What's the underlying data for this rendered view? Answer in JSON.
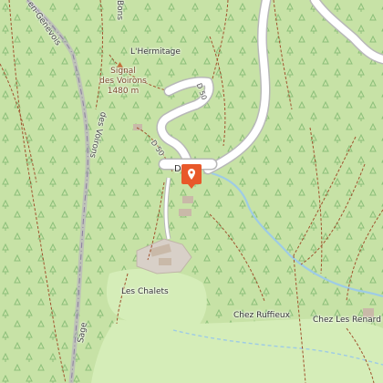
{
  "map": {
    "place_labels": {
      "hermitage": "L'Hermitage",
      "les_chalets": "Les Chalets",
      "chez_ruffieux": "Chez Ruffieux",
      "chez_les_renard": "Chez Les Renard",
      "d_label": "D"
    },
    "peak": {
      "name": "Signal",
      "name2": "des Voirons",
      "elevation": "1480 m"
    },
    "road_labels": {
      "d50_upper": "D 50",
      "d50_lower": "D 50"
    },
    "path_labels": {
      "genevois": "en-Genevois",
      "bons": "Bons",
      "voirons": "des Voirons",
      "sage": "Sage"
    },
    "icons": {
      "marker": "map-pin-icon",
      "peak": "peak-triangle-icon"
    },
    "colors": {
      "forest": "#c7e2a6",
      "meadow": "#d5edb8",
      "road": "#ffffff",
      "road_casing": "#b0b0b0",
      "path": "#a0522d",
      "stream": "#9ecbe5",
      "marker": "#e8582a",
      "boundary": "#9a8fa6"
    }
  }
}
